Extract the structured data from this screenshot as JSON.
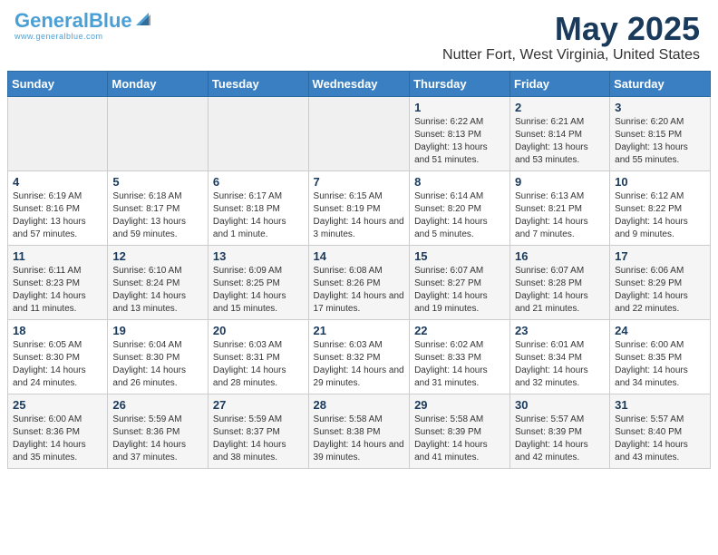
{
  "header": {
    "logo_general": "General",
    "logo_blue": "Blue",
    "title": "May 2025",
    "subtitle": "Nutter Fort, West Virginia, United States"
  },
  "calendar": {
    "days_of_week": [
      "Sunday",
      "Monday",
      "Tuesday",
      "Wednesday",
      "Thursday",
      "Friday",
      "Saturday"
    ],
    "weeks": [
      [
        {
          "day": "",
          "info": ""
        },
        {
          "day": "",
          "info": ""
        },
        {
          "day": "",
          "info": ""
        },
        {
          "day": "",
          "info": ""
        },
        {
          "day": "1",
          "info": "Sunrise: 6:22 AM\nSunset: 8:13 PM\nDaylight: 13 hours and 51 minutes."
        },
        {
          "day": "2",
          "info": "Sunrise: 6:21 AM\nSunset: 8:14 PM\nDaylight: 13 hours and 53 minutes."
        },
        {
          "day": "3",
          "info": "Sunrise: 6:20 AM\nSunset: 8:15 PM\nDaylight: 13 hours and 55 minutes."
        }
      ],
      [
        {
          "day": "4",
          "info": "Sunrise: 6:19 AM\nSunset: 8:16 PM\nDaylight: 13 hours and 57 minutes."
        },
        {
          "day": "5",
          "info": "Sunrise: 6:18 AM\nSunset: 8:17 PM\nDaylight: 13 hours and 59 minutes."
        },
        {
          "day": "6",
          "info": "Sunrise: 6:17 AM\nSunset: 8:18 PM\nDaylight: 14 hours and 1 minute."
        },
        {
          "day": "7",
          "info": "Sunrise: 6:15 AM\nSunset: 8:19 PM\nDaylight: 14 hours and 3 minutes."
        },
        {
          "day": "8",
          "info": "Sunrise: 6:14 AM\nSunset: 8:20 PM\nDaylight: 14 hours and 5 minutes."
        },
        {
          "day": "9",
          "info": "Sunrise: 6:13 AM\nSunset: 8:21 PM\nDaylight: 14 hours and 7 minutes."
        },
        {
          "day": "10",
          "info": "Sunrise: 6:12 AM\nSunset: 8:22 PM\nDaylight: 14 hours and 9 minutes."
        }
      ],
      [
        {
          "day": "11",
          "info": "Sunrise: 6:11 AM\nSunset: 8:23 PM\nDaylight: 14 hours and 11 minutes."
        },
        {
          "day": "12",
          "info": "Sunrise: 6:10 AM\nSunset: 8:24 PM\nDaylight: 14 hours and 13 minutes."
        },
        {
          "day": "13",
          "info": "Sunrise: 6:09 AM\nSunset: 8:25 PM\nDaylight: 14 hours and 15 minutes."
        },
        {
          "day": "14",
          "info": "Sunrise: 6:08 AM\nSunset: 8:26 PM\nDaylight: 14 hours and 17 minutes."
        },
        {
          "day": "15",
          "info": "Sunrise: 6:07 AM\nSunset: 8:27 PM\nDaylight: 14 hours and 19 minutes."
        },
        {
          "day": "16",
          "info": "Sunrise: 6:07 AM\nSunset: 8:28 PM\nDaylight: 14 hours and 21 minutes."
        },
        {
          "day": "17",
          "info": "Sunrise: 6:06 AM\nSunset: 8:29 PM\nDaylight: 14 hours and 22 minutes."
        }
      ],
      [
        {
          "day": "18",
          "info": "Sunrise: 6:05 AM\nSunset: 8:30 PM\nDaylight: 14 hours and 24 minutes."
        },
        {
          "day": "19",
          "info": "Sunrise: 6:04 AM\nSunset: 8:30 PM\nDaylight: 14 hours and 26 minutes."
        },
        {
          "day": "20",
          "info": "Sunrise: 6:03 AM\nSunset: 8:31 PM\nDaylight: 14 hours and 28 minutes."
        },
        {
          "day": "21",
          "info": "Sunrise: 6:03 AM\nSunset: 8:32 PM\nDaylight: 14 hours and 29 minutes."
        },
        {
          "day": "22",
          "info": "Sunrise: 6:02 AM\nSunset: 8:33 PM\nDaylight: 14 hours and 31 minutes."
        },
        {
          "day": "23",
          "info": "Sunrise: 6:01 AM\nSunset: 8:34 PM\nDaylight: 14 hours and 32 minutes."
        },
        {
          "day": "24",
          "info": "Sunrise: 6:00 AM\nSunset: 8:35 PM\nDaylight: 14 hours and 34 minutes."
        }
      ],
      [
        {
          "day": "25",
          "info": "Sunrise: 6:00 AM\nSunset: 8:36 PM\nDaylight: 14 hours and 35 minutes."
        },
        {
          "day": "26",
          "info": "Sunrise: 5:59 AM\nSunset: 8:36 PM\nDaylight: 14 hours and 37 minutes."
        },
        {
          "day": "27",
          "info": "Sunrise: 5:59 AM\nSunset: 8:37 PM\nDaylight: 14 hours and 38 minutes."
        },
        {
          "day": "28",
          "info": "Sunrise: 5:58 AM\nSunset: 8:38 PM\nDaylight: 14 hours and 39 minutes."
        },
        {
          "day": "29",
          "info": "Sunrise: 5:58 AM\nSunset: 8:39 PM\nDaylight: 14 hours and 41 minutes."
        },
        {
          "day": "30",
          "info": "Sunrise: 5:57 AM\nSunset: 8:39 PM\nDaylight: 14 hours and 42 minutes."
        },
        {
          "day": "31",
          "info": "Sunrise: 5:57 AM\nSunset: 8:40 PM\nDaylight: 14 hours and 43 minutes."
        }
      ]
    ]
  }
}
